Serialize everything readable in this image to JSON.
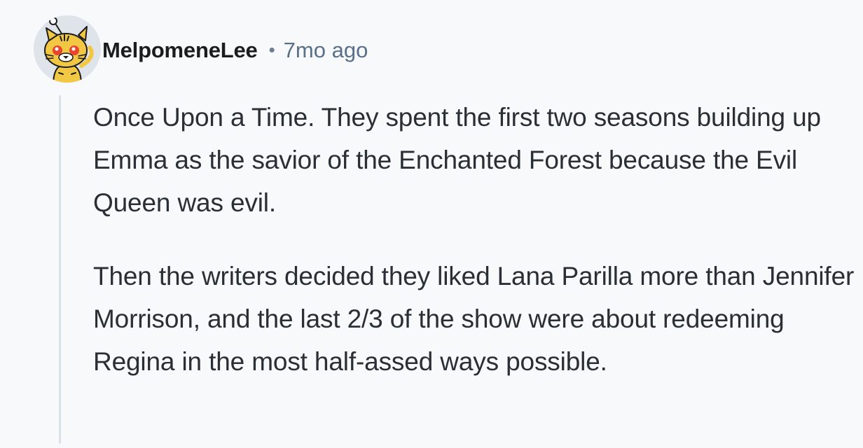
{
  "comment": {
    "avatar": {
      "icon": "snoo-avatar-icon",
      "alt": "MelpomeneLee avatar"
    },
    "author": "MelpomeneLee",
    "separator": "•",
    "timestamp": "7mo ago",
    "paragraphs": [
      "Once Upon a Time. They spent the first two seasons building up Emma as the savior of the Enchanted Forest because the Evil Queen was evil.",
      "Then the writers decided they liked Lana Parilla more than Jennifer Morrison, and the last 2/3 of the show were about redeeming Regina in the most half-assed ways possible."
    ]
  },
  "colors": {
    "background": "#f7f9fb",
    "text": "#2a2f35",
    "meta": "#59708a",
    "thread_line": "#d8e0e8"
  }
}
